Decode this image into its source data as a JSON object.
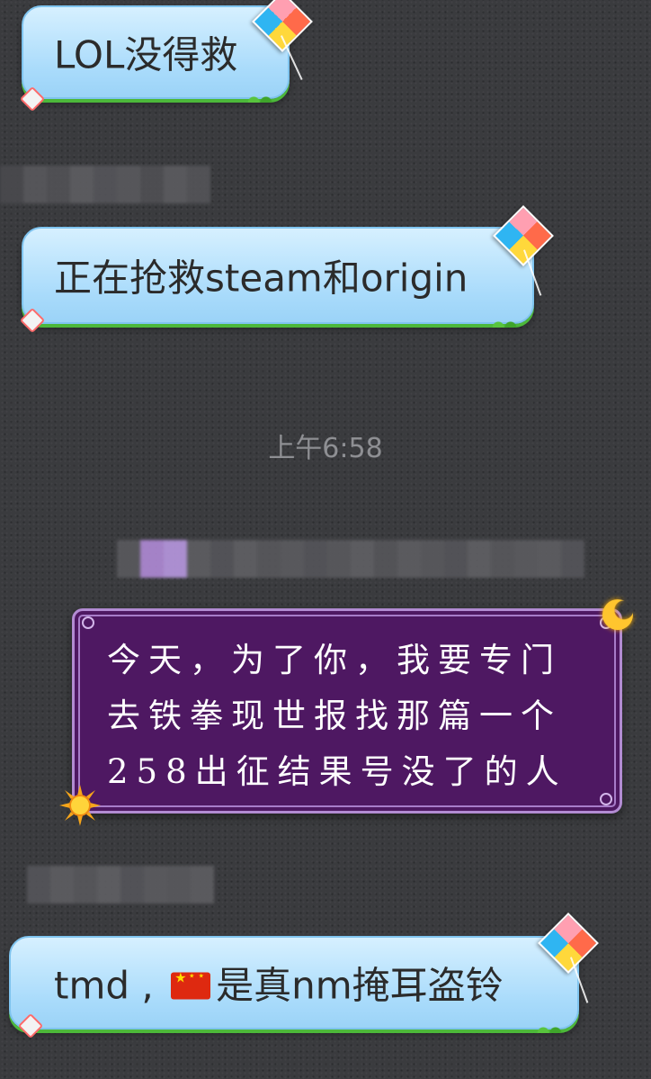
{
  "messages": {
    "msg1": {
      "text": "LOL没得救"
    },
    "msg2": {
      "text": "正在抢救steam和origin"
    },
    "timestamp": "上午6:58",
    "msg3": {
      "lines": [
        "今天，为了你，我要专门",
        "去铁拳现世报找那篇一个",
        "258出征结果号没了的人"
      ]
    },
    "msg4": {
      "before_flag": "tmd , ",
      "after_flag": "是真nm掩耳盗铃"
    }
  },
  "icons": {
    "kite": "kite-icon",
    "moon": "moon-icon",
    "sun": "sun-icon",
    "flag": "china-flag-icon"
  },
  "colors": {
    "incoming_bubble": "#a9dbfb",
    "outgoing_bubble": "#4e1862",
    "grass": "#4cb83a",
    "timestamp": "#8e8f93"
  }
}
